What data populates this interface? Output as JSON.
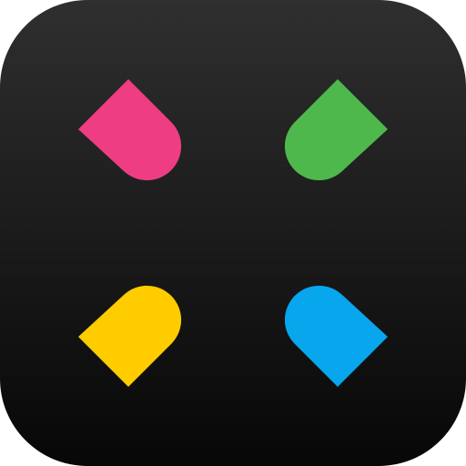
{
  "app_icon": {
    "background": {
      "gradient_top": "#2f2f2f",
      "gradient_bottom": "#070707"
    },
    "pieces": [
      {
        "name": "pink-piece-icon",
        "color": "#ee3d82"
      },
      {
        "name": "green-piece-icon",
        "color": "#4fb84c"
      },
      {
        "name": "yellow-piece-icon",
        "color": "#ffcc00"
      },
      {
        "name": "blue-piece-icon",
        "color": "#08a6ed"
      }
    ]
  }
}
